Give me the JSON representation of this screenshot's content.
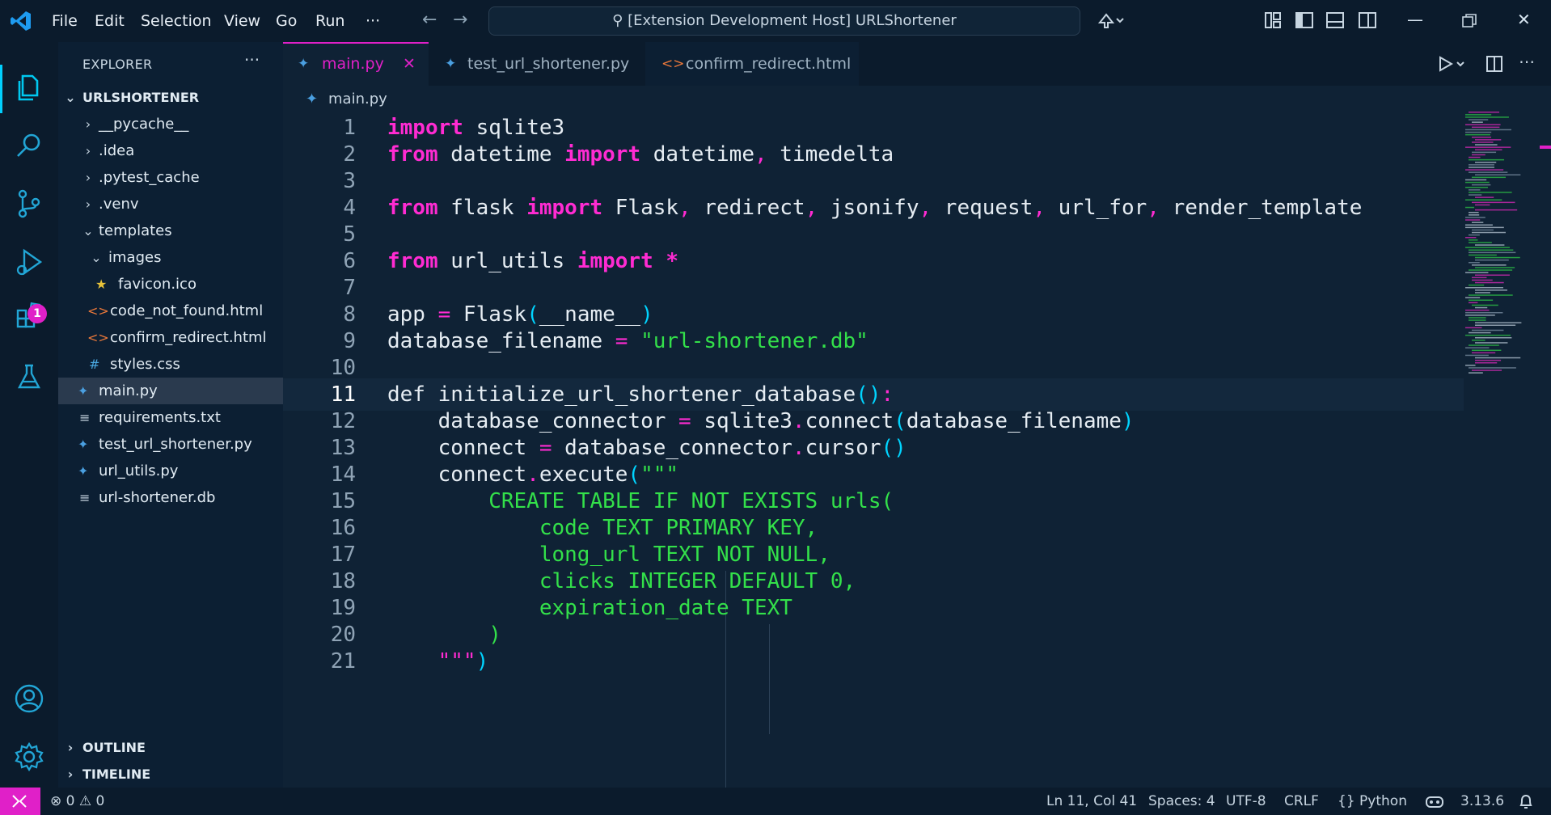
{
  "titlebar": {
    "menus": [
      "File",
      "Edit",
      "Selection",
      "View",
      "Go",
      "Run"
    ],
    "more": "···",
    "search_text": "[Extension Development Host] URLShortener"
  },
  "activity": {
    "items": [
      "explorer-icon",
      "search-icon",
      "source-control-icon",
      "run-debug-icon",
      "extensions-icon",
      "testing-icon"
    ],
    "extensions_badge": "1",
    "bottom": [
      "account-icon",
      "settings-gear-icon"
    ]
  },
  "sidebar": {
    "title": "EXPLORER",
    "more": "···",
    "root": "URLSHORTENER",
    "items": [
      {
        "label": "__pycache__",
        "type": "folder"
      },
      {
        "label": ".idea",
        "type": "folder"
      },
      {
        "label": ".pytest_cache",
        "type": "folder"
      },
      {
        "label": ".venv",
        "type": "folder"
      },
      {
        "label": "templates",
        "type": "folder-open"
      },
      {
        "label": "images",
        "type": "folder-open"
      },
      {
        "label": "favicon.ico",
        "type": "star"
      },
      {
        "label": "code_not_found.html",
        "type": "html"
      },
      {
        "label": "confirm_redirect.html",
        "type": "html"
      },
      {
        "label": "styles.css",
        "type": "css"
      },
      {
        "label": "main.py",
        "type": "python"
      },
      {
        "label": "requirements.txt",
        "type": "text"
      },
      {
        "label": "test_url_shortener.py",
        "type": "python"
      },
      {
        "label": "url_utils.py",
        "type": "python"
      },
      {
        "label": "url-shortener.db",
        "type": "text"
      }
    ],
    "outline": "OUTLINE",
    "timeline": "TIMELINE"
  },
  "tabs": [
    {
      "label": "main.py",
      "icon": "python",
      "active": true
    },
    {
      "label": "test_url_shortener.py",
      "icon": "python",
      "active": false
    },
    {
      "label": "confirm_redirect.html",
      "icon": "html",
      "active": false
    }
  ],
  "breadcrumb": "main.py",
  "editor": {
    "current_line": 11,
    "lines": [
      {
        "n": "1"
      },
      {
        "n": "2"
      },
      {
        "n": "3"
      },
      {
        "n": "4"
      },
      {
        "n": "5"
      },
      {
        "n": "6"
      },
      {
        "n": "7"
      },
      {
        "n": "8"
      },
      {
        "n": "9"
      },
      {
        "n": "10"
      },
      {
        "n": "11"
      },
      {
        "n": "12"
      },
      {
        "n": "13"
      },
      {
        "n": "14"
      },
      {
        "n": "15"
      },
      {
        "n": "16"
      },
      {
        "n": "17"
      },
      {
        "n": "18"
      },
      {
        "n": "19"
      },
      {
        "n": "20"
      },
      {
        "n": "21"
      }
    ],
    "code": {
      "l1_kw": "import",
      "l1_rest": " sqlite3",
      "l2_kw1": "from",
      "l2_a": " datetime ",
      "l2_kw2": "import",
      "l2_b": " datetime",
      "l2_c": ",",
      "l2_d": " timedelta",
      "l4_kw1": "from",
      "l4_a": " flask ",
      "l4_kw2": "import",
      "l4_b": " Flask",
      "l4_c1": ",",
      "l4_d": " redirect",
      "l4_c2": ",",
      "l4_e": " jsonify",
      "l4_c3": ",",
      "l4_f": " request",
      "l4_c4": ",",
      "l4_g": " url_for",
      "l4_c5": ",",
      "l4_h": " render_template",
      "l6_kw1": "from",
      "l6_a": " url_utils ",
      "l6_kw2": "import",
      "l6_star": " *",
      "l8_a": "app ",
      "l8_eq": "=",
      "l8_b": " Flask",
      "l8_p1": "(",
      "l8_c": "__name__",
      "l8_p2": ")",
      "l9_a": "database_filename ",
      "l9_eq": "=",
      "l9_s": " \"url-shortener.db\"",
      "l11_a": "def initialize_url_shortener_database",
      "l11_p": "()",
      "l11_c": ":",
      "l12_a": "    database_connector ",
      "l12_eq": "=",
      "l12_b": " sqlite3",
      "l12_dot": ".",
      "l12_c": "connect",
      "l12_p1": "(",
      "l12_d": "database_filename",
      "l12_p2": ")",
      "l13_a": "    connect ",
      "l13_eq": "=",
      "l13_b": " database_connector",
      "l13_dot": ".",
      "l13_c": "cursor",
      "l13_p": "()",
      "l14_a": "    connect",
      "l14_dot": ".",
      "l14_b": "execute",
      "l14_p": "(",
      "l14_s": "\"\"\"",
      "l15": "        CREATE TABLE IF NOT EXISTS urls(",
      "l16": "            code TEXT PRIMARY KEY,",
      "l17": "            long_url TEXT NOT NULL,",
      "l18": "            clicks INTEGER DEFAULT 0,",
      "l19": "            expiration_date TEXT",
      "l20": "        )",
      "l21_s": "    \"\"\"",
      "l21_p": ")"
    }
  },
  "status": {
    "errors": "0",
    "warnings": "0",
    "position": "Ln 11, Col 41",
    "spaces": "Spaces: 4",
    "encoding": "UTF-8",
    "eol": "CRLF",
    "language": "Python",
    "version": "3.13.6"
  },
  "colors": {
    "accent": "#e020c8",
    "keyword": "#ff2bd2",
    "string": "#33e04a",
    "bracket": "#00d4ff",
    "background": "#0f2235"
  }
}
